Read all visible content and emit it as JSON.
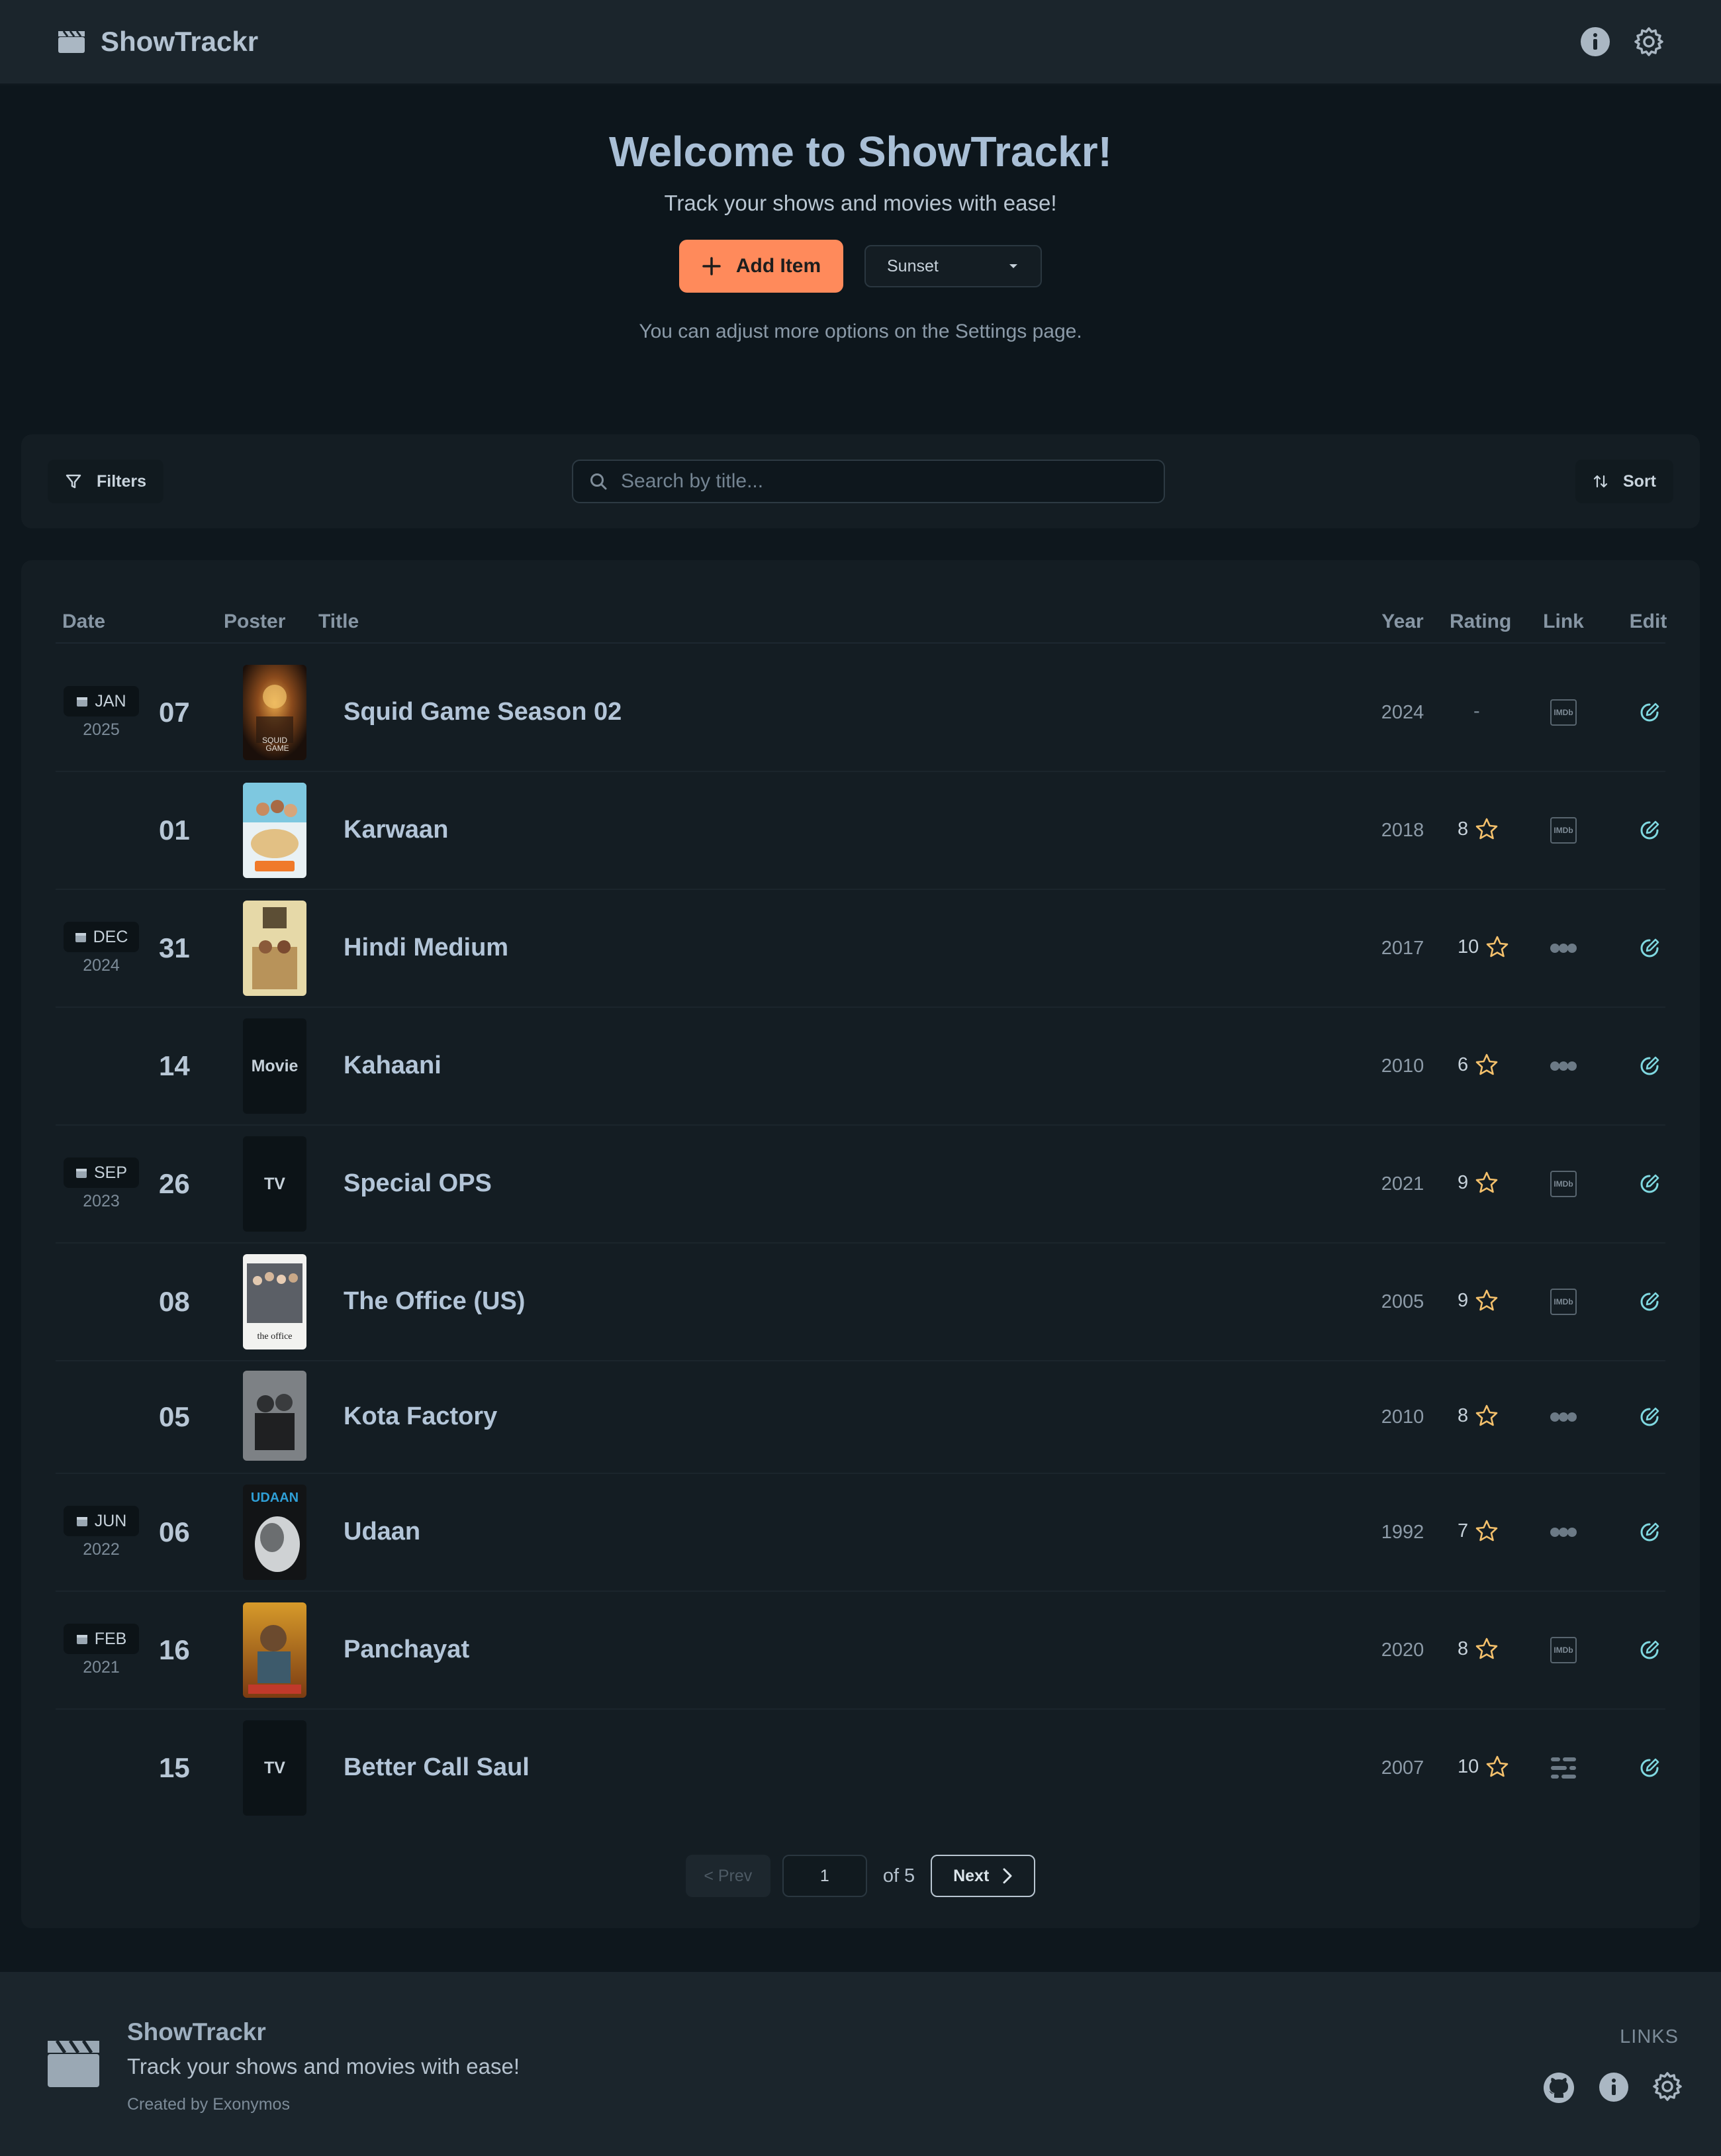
{
  "app": {
    "name": "ShowTrackr"
  },
  "hero": {
    "title": "Welcome to ShowTrackr!",
    "subtitle": "Track your shows and movies with ease!",
    "add_label": "Add Item",
    "theme_value": "Sunset",
    "note": "You can adjust more options on the Settings page."
  },
  "toolbar": {
    "filters_label": "Filters",
    "search_placeholder": "Search by title...",
    "sort_label": "Sort"
  },
  "table": {
    "headers": {
      "date": "Date",
      "poster": "Poster",
      "title": "Title",
      "year": "Year",
      "rating": "Rating",
      "link": "Link",
      "edit": "Edit"
    },
    "rows": [
      {
        "month": "JAN",
        "year_group": "2025",
        "day": "07",
        "title": "Squid Game Season 02",
        "year": "2024",
        "rating": "-",
        "link": "imdb",
        "poster": "image"
      },
      {
        "month": "",
        "year_group": "",
        "day": "01",
        "title": "Karwaan",
        "year": "2018",
        "rating": "8",
        "link": "imdb",
        "poster": "image"
      },
      {
        "month": "DEC",
        "year_group": "2024",
        "day": "31",
        "title": "Hindi Medium",
        "year": "2017",
        "rating": "10",
        "link": "letterboxd",
        "poster": "image"
      },
      {
        "month": "",
        "year_group": "",
        "day": "14",
        "title": "Kahaani",
        "year": "2010",
        "rating": "6",
        "link": "letterboxd",
        "poster": "Movie"
      },
      {
        "month": "SEP",
        "year_group": "2023",
        "day": "26",
        "title": "Special OPS",
        "year": "2021",
        "rating": "9",
        "link": "imdb",
        "poster": "TV"
      },
      {
        "month": "",
        "year_group": "",
        "day": "08",
        "title": "The Office (US)",
        "year": "2005",
        "rating": "9",
        "link": "imdb",
        "poster": "image"
      },
      {
        "month": "",
        "year_group": "",
        "day": "05",
        "title": "Kota Factory",
        "year": "2010",
        "rating": "8",
        "link": "letterboxd",
        "poster": "image"
      },
      {
        "month": "JUN",
        "year_group": "2022",
        "day": "06",
        "title": "Udaan",
        "year": "1992",
        "rating": "7",
        "link": "letterboxd",
        "poster": "image"
      },
      {
        "month": "FEB",
        "year_group": "2021",
        "day": "16",
        "title": "Panchayat",
        "year": "2020",
        "rating": "8",
        "link": "imdb",
        "poster": "image"
      },
      {
        "month": "",
        "year_group": "",
        "day": "15",
        "title": "Better Call Saul",
        "year": "2007",
        "rating": "10",
        "link": "tmdb",
        "poster": "TV"
      }
    ]
  },
  "pagination": {
    "prev_label": "< Prev",
    "page": "1",
    "of_label": "of 5",
    "next_label": "Next"
  },
  "footer": {
    "name": "ShowTrackr",
    "tagline": "Track your shows and movies with ease!",
    "credit": "Created by Exonymos",
    "links_label": "LINKS"
  },
  "colors": {
    "accent": "#ff8a5b",
    "background": "#0e171d",
    "surface": "#141d23",
    "star": "#f5c16c",
    "edit": "#7fd8e0"
  }
}
